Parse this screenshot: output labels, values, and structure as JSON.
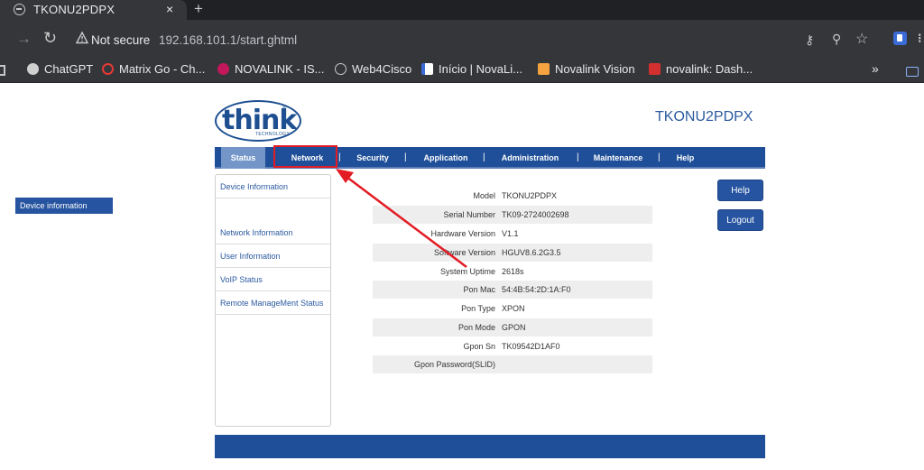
{
  "browser": {
    "tab_title": "TKONU2PDPX",
    "tab_close": "×",
    "new_tab": "+",
    "not_secure": "Not secure",
    "url": "192.168.101.1/start.ghtml",
    "bookmarks": [
      {
        "label": "ChatGPT",
        "icon": "chatgpt-icon",
        "color": "#d0d0d0"
      },
      {
        "label": "Matrix Go - Ch...",
        "icon": "matrix-icon",
        "color": "#e53935"
      },
      {
        "label": "NOVALINK - IS...",
        "icon": "novalink-icon",
        "color": "#c2185b"
      },
      {
        "label": "Web4Cisco",
        "icon": "globe-icon",
        "color": "#c8c8c8"
      },
      {
        "label": "Início | NovaLi...",
        "icon": "novalink-g-icon",
        "color": "#ffffff"
      },
      {
        "label": "Novalink Vision",
        "icon": "vision-icon",
        "color": "#f4a340"
      },
      {
        "label": "novalink: Dash...",
        "icon": "zabbix-icon",
        "color": "#d32f2f"
      }
    ],
    "bookmarks_more": "»"
  },
  "page": {
    "logo_word": "think",
    "logo_sub": "TECHNOLOGY",
    "logo_reg": "®",
    "device_title": "TKONU2PDPX",
    "accent_color": "#1f4f98",
    "highlight_color": "#e31b23"
  },
  "nav": {
    "items": [
      "Status",
      "Network",
      "Security",
      "Application",
      "Administration",
      "Maintenance",
      "Help"
    ],
    "separator": "|",
    "active": "Status"
  },
  "sidebar": {
    "items": [
      "Device Information",
      "Network Information",
      "User Information",
      "VoIP Status",
      "Remote ManageMent Status"
    ],
    "sub_item": "Device information"
  },
  "info": [
    {
      "label": "Model",
      "value": "TKONU2PDPX"
    },
    {
      "label": "Serial Number",
      "value": "TK09-2724002698"
    },
    {
      "label": "Hardware Version",
      "value": "V1.1"
    },
    {
      "label": "Software Version",
      "value": "HGUV8.6.2G3.5"
    },
    {
      "label": "System Uptime",
      "value": "2618s"
    },
    {
      "label": "Pon Mac",
      "value": "54:4B:54:2D:1A:F0"
    },
    {
      "label": "Pon Type",
      "value": "XPON"
    },
    {
      "label": "Pon Mode",
      "value": "GPON"
    },
    {
      "label": "Gpon Sn",
      "value": "TK09542D1AF0"
    },
    {
      "label": "Gpon Password(SLID)",
      "value": ""
    }
  ],
  "buttons": {
    "help": "Help",
    "logout": "Logout"
  }
}
